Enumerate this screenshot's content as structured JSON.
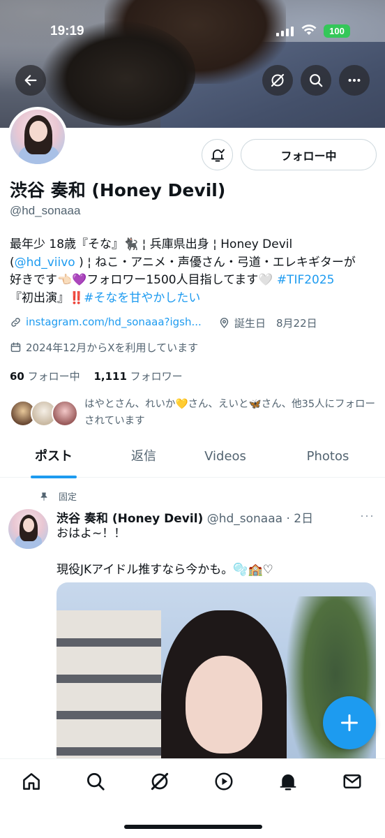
{
  "status_bar": {
    "time": "19:19",
    "battery": "100"
  },
  "header_actions": {
    "back_icon": "arrow-left-icon",
    "grok_icon": "grok-icon",
    "search_icon": "search-icon",
    "more_icon": "more-horizontal-icon"
  },
  "profile": {
    "display_name": "渋谷 奏和 (Honey Devil)",
    "handle": "@hd_sonaaa",
    "follow_button": "フォロー中",
    "bio": {
      "line1": "最年少 18歳『そな』🐈‍⬛ ¦ 兵庫県出身 ¦ Honey Devil",
      "mention_prefix": "(",
      "mention": "@hd_viivo",
      "line2_after_mention": " ) ¦ ねこ・アニメ・声優さん・弓道・エレキギターが",
      "line3": "好きです👈🏻💜フォロワー1500人目指してます🤍 ",
      "hashtag1": "#TIF2025",
      "line4_prefix": "『初出演』",
      "exclaim": "‼️",
      "hashtag2": "#そなを甘やかしたい"
    },
    "link": "instagram.com/hd_sonaaa?igsh...",
    "birthday": "誕生日　8月22日",
    "joined": "2024年12月からXを利用しています",
    "following_count": "60",
    "following_label": " フォロー中　",
    "followers_count": "1,111",
    "followers_label": " フォロワー",
    "followed_by": "はやとさん、れいか💛さん、えいと🦋さん、他35人にフォローされています"
  },
  "tabs": [
    {
      "label": "ポスト"
    },
    {
      "label": "返信"
    },
    {
      "label": "Videos"
    },
    {
      "label": "Photos"
    }
  ],
  "post": {
    "pinned_label": "固定",
    "author_name": "渋谷 奏和 (Honey Devil)",
    "author_meta": " @hd_sonaaa · 2日",
    "text": "おはよ~！！\n\n現役JKアイドル推すなら今かも。🫧🏫♡",
    "more": "···"
  },
  "colors": {
    "accent": "#1d9bf0",
    "text": "#0f1419",
    "muted": "#536471",
    "battery": "#34c759"
  },
  "bottom_nav": [
    "home-icon",
    "search-icon",
    "grok-icon",
    "play-icon",
    "notifications-icon",
    "messages-icon"
  ]
}
